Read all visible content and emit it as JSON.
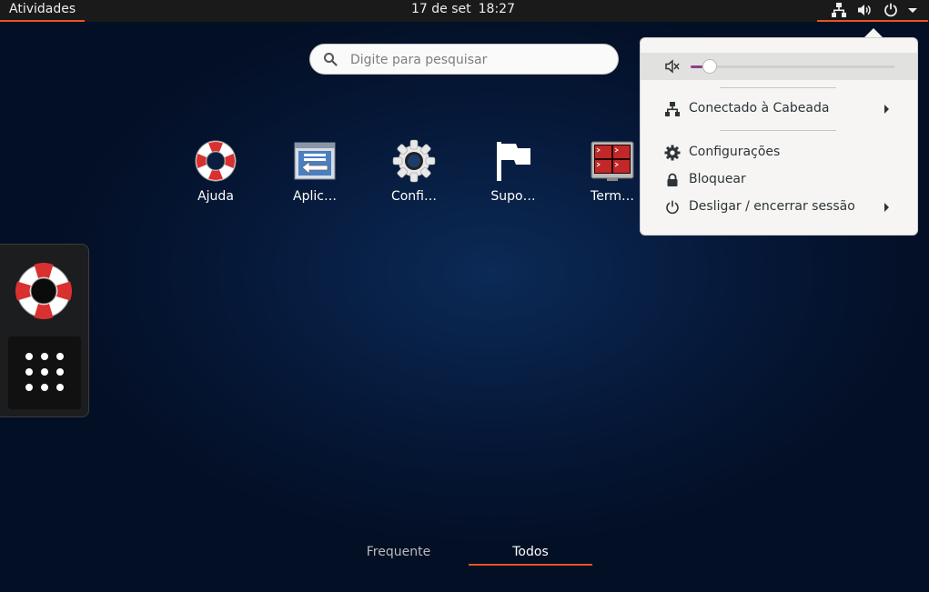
{
  "topbar": {
    "activities": "Atividades",
    "date": "17 de set",
    "time": "18:27",
    "icons": [
      "network-icon",
      "volume-icon",
      "power-icon",
      "menu-arrow-icon"
    ]
  },
  "search": {
    "placeholder": "Digite para pesquisar",
    "value": ""
  },
  "apps": [
    {
      "label": "Ajuda",
      "icon": "help-lifebuoy-icon"
    },
    {
      "label": "Aplic…",
      "icon": "applications-window-icon"
    },
    {
      "label": "Confi…",
      "icon": "settings-gear-icon"
    },
    {
      "label": "Supo…",
      "icon": "flag-icon"
    },
    {
      "label": "Term…",
      "icon": "terminal-icon"
    }
  ],
  "dash": {
    "favorite_icon": "help-lifebuoy-icon",
    "show_apps_icon": "grid-dots-icon"
  },
  "tabs": {
    "frequent": "Frequente",
    "all": "Todos",
    "selected": "all"
  },
  "system_menu": {
    "volume": {
      "icon": "volume-muted-icon",
      "level": 0.04
    },
    "network": {
      "label": "Conectado à Cabeada",
      "icon": "wired-network-icon"
    },
    "settings": {
      "label": "Configurações",
      "icon": "gear-icon"
    },
    "lock": {
      "label": "Bloquear",
      "icon": "lock-icon"
    },
    "power": {
      "label": "Desligar / encerrar sessão",
      "icon": "power-icon"
    }
  },
  "colors": {
    "accent": "#e95420",
    "slider_fill": "#8e3e8c",
    "menu_bg": "#f6f5f4"
  }
}
